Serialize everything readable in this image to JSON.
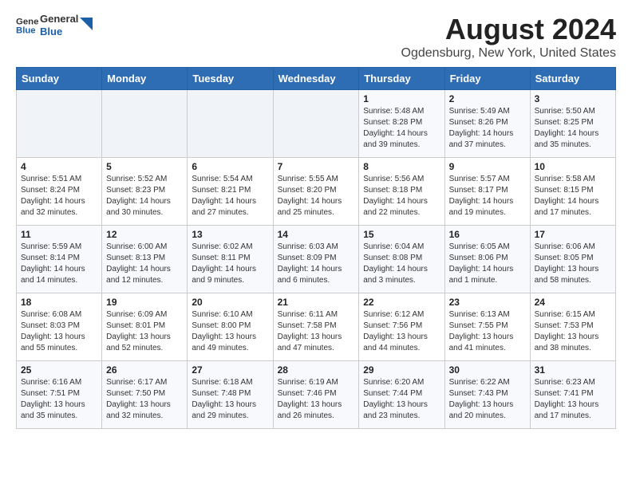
{
  "header": {
    "logo_line1": "General",
    "logo_line2": "Blue",
    "title": "August 2024",
    "subtitle": "Ogdensburg, New York, United States"
  },
  "calendar": {
    "days_of_week": [
      "Sunday",
      "Monday",
      "Tuesday",
      "Wednesday",
      "Thursday",
      "Friday",
      "Saturday"
    ],
    "weeks": [
      [
        {
          "day": "",
          "info": ""
        },
        {
          "day": "",
          "info": ""
        },
        {
          "day": "",
          "info": ""
        },
        {
          "day": "",
          "info": ""
        },
        {
          "day": "1",
          "info": "Sunrise: 5:48 AM\nSunset: 8:28 PM\nDaylight: 14 hours\nand 39 minutes."
        },
        {
          "day": "2",
          "info": "Sunrise: 5:49 AM\nSunset: 8:26 PM\nDaylight: 14 hours\nand 37 minutes."
        },
        {
          "day": "3",
          "info": "Sunrise: 5:50 AM\nSunset: 8:25 PM\nDaylight: 14 hours\nand 35 minutes."
        }
      ],
      [
        {
          "day": "4",
          "info": "Sunrise: 5:51 AM\nSunset: 8:24 PM\nDaylight: 14 hours\nand 32 minutes."
        },
        {
          "day": "5",
          "info": "Sunrise: 5:52 AM\nSunset: 8:23 PM\nDaylight: 14 hours\nand 30 minutes."
        },
        {
          "day": "6",
          "info": "Sunrise: 5:54 AM\nSunset: 8:21 PM\nDaylight: 14 hours\nand 27 minutes."
        },
        {
          "day": "7",
          "info": "Sunrise: 5:55 AM\nSunset: 8:20 PM\nDaylight: 14 hours\nand 25 minutes."
        },
        {
          "day": "8",
          "info": "Sunrise: 5:56 AM\nSunset: 8:18 PM\nDaylight: 14 hours\nand 22 minutes."
        },
        {
          "day": "9",
          "info": "Sunrise: 5:57 AM\nSunset: 8:17 PM\nDaylight: 14 hours\nand 19 minutes."
        },
        {
          "day": "10",
          "info": "Sunrise: 5:58 AM\nSunset: 8:15 PM\nDaylight: 14 hours\nand 17 minutes."
        }
      ],
      [
        {
          "day": "11",
          "info": "Sunrise: 5:59 AM\nSunset: 8:14 PM\nDaylight: 14 hours\nand 14 minutes."
        },
        {
          "day": "12",
          "info": "Sunrise: 6:00 AM\nSunset: 8:13 PM\nDaylight: 14 hours\nand 12 minutes."
        },
        {
          "day": "13",
          "info": "Sunrise: 6:02 AM\nSunset: 8:11 PM\nDaylight: 14 hours\nand 9 minutes."
        },
        {
          "day": "14",
          "info": "Sunrise: 6:03 AM\nSunset: 8:09 PM\nDaylight: 14 hours\nand 6 minutes."
        },
        {
          "day": "15",
          "info": "Sunrise: 6:04 AM\nSunset: 8:08 PM\nDaylight: 14 hours\nand 3 minutes."
        },
        {
          "day": "16",
          "info": "Sunrise: 6:05 AM\nSunset: 8:06 PM\nDaylight: 14 hours\nand 1 minute."
        },
        {
          "day": "17",
          "info": "Sunrise: 6:06 AM\nSunset: 8:05 PM\nDaylight: 13 hours\nand 58 minutes."
        }
      ],
      [
        {
          "day": "18",
          "info": "Sunrise: 6:08 AM\nSunset: 8:03 PM\nDaylight: 13 hours\nand 55 minutes."
        },
        {
          "day": "19",
          "info": "Sunrise: 6:09 AM\nSunset: 8:01 PM\nDaylight: 13 hours\nand 52 minutes."
        },
        {
          "day": "20",
          "info": "Sunrise: 6:10 AM\nSunset: 8:00 PM\nDaylight: 13 hours\nand 49 minutes."
        },
        {
          "day": "21",
          "info": "Sunrise: 6:11 AM\nSunset: 7:58 PM\nDaylight: 13 hours\nand 47 minutes."
        },
        {
          "day": "22",
          "info": "Sunrise: 6:12 AM\nSunset: 7:56 PM\nDaylight: 13 hours\nand 44 minutes."
        },
        {
          "day": "23",
          "info": "Sunrise: 6:13 AM\nSunset: 7:55 PM\nDaylight: 13 hours\nand 41 minutes."
        },
        {
          "day": "24",
          "info": "Sunrise: 6:15 AM\nSunset: 7:53 PM\nDaylight: 13 hours\nand 38 minutes."
        }
      ],
      [
        {
          "day": "25",
          "info": "Sunrise: 6:16 AM\nSunset: 7:51 PM\nDaylight: 13 hours\nand 35 minutes."
        },
        {
          "day": "26",
          "info": "Sunrise: 6:17 AM\nSunset: 7:50 PM\nDaylight: 13 hours\nand 32 minutes."
        },
        {
          "day": "27",
          "info": "Sunrise: 6:18 AM\nSunset: 7:48 PM\nDaylight: 13 hours\nand 29 minutes."
        },
        {
          "day": "28",
          "info": "Sunrise: 6:19 AM\nSunset: 7:46 PM\nDaylight: 13 hours\nand 26 minutes."
        },
        {
          "day": "29",
          "info": "Sunrise: 6:20 AM\nSunset: 7:44 PM\nDaylight: 13 hours\nand 23 minutes."
        },
        {
          "day": "30",
          "info": "Sunrise: 6:22 AM\nSunset: 7:43 PM\nDaylight: 13 hours\nand 20 minutes."
        },
        {
          "day": "31",
          "info": "Sunrise: 6:23 AM\nSunset: 7:41 PM\nDaylight: 13 hours\nand 17 minutes."
        }
      ]
    ]
  }
}
